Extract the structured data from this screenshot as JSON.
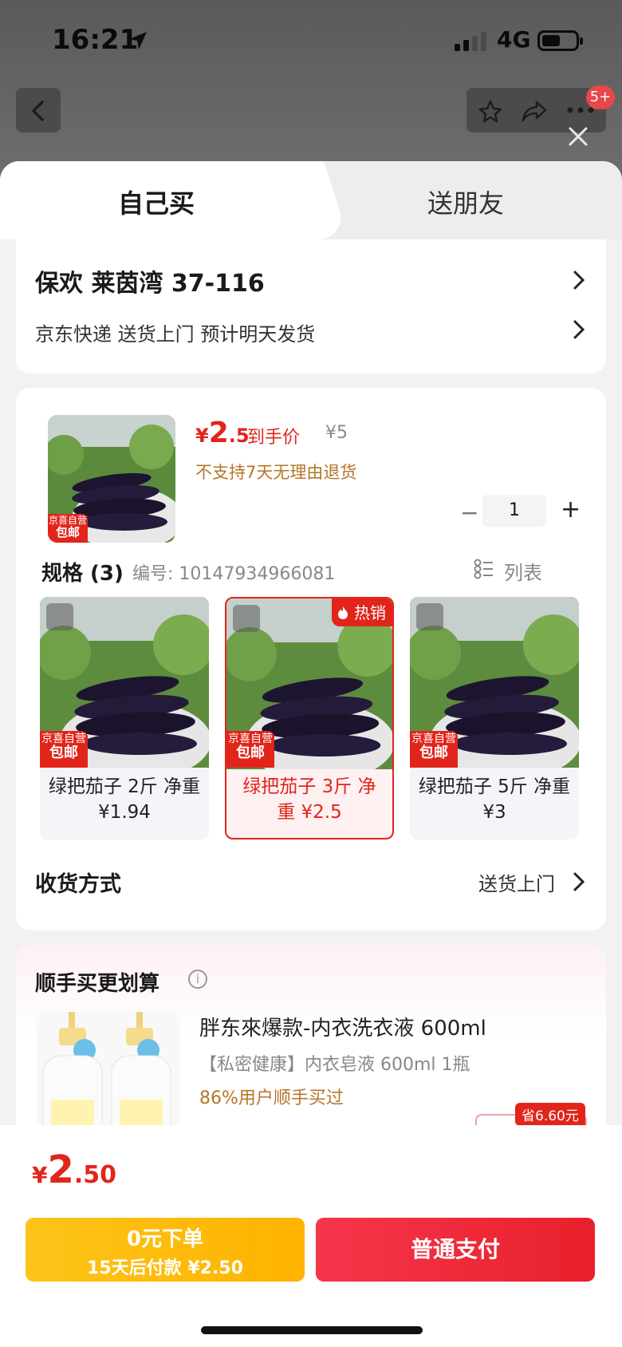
{
  "status_bar": {
    "time": "16:21",
    "network": "4G"
  },
  "nav": {
    "badge": "5+"
  },
  "tabs": {
    "self": "自己买",
    "friend": "送朋友"
  },
  "address": {
    "name_line": "保欢  莱茵湾 37-116",
    "delivery_line": "京东快递 送货上门 预计明天发货"
  },
  "product": {
    "tag_line1": "京喜自营",
    "tag_line2": "包邮",
    "price_yen": "¥",
    "price_int": "2",
    "price_dec": ".5",
    "price_label": "到手价",
    "original_price": "¥5",
    "return_policy": "不支持7天无理由退货",
    "quantity": "1",
    "minus": "−",
    "plus": "+"
  },
  "specs": {
    "title": "规格 (3)",
    "sku": "编号: 10147934966081",
    "list_label": "列表",
    "hot_label": "热销",
    "variants": [
      {
        "name": "绿把茄子 2斤 净重 ¥1.94",
        "selected": false
      },
      {
        "name": "绿把茄子 3斤 净重 ¥2.5",
        "selected": true
      },
      {
        "name": "绿把茄子 5斤 净重 ¥3",
        "selected": false
      }
    ]
  },
  "receiving": {
    "label": "收货方式",
    "value": "送货上门"
  },
  "addon": {
    "title": "顺手买更划算",
    "info": "i",
    "product_name": "胖东來爆款-内衣洗衣液 600ml",
    "product_sub": "【私密健康】内衣皂液 600ml 1瓶",
    "rate": "86%用户顺手买过",
    "save_badge": "省6.60元"
  },
  "bottom": {
    "total_yen": "¥",
    "total_int": "2",
    "total_dec": ".50",
    "credit_line1": "0元下单",
    "credit_line2": "15天后付款 ¥2.50",
    "pay_label": "普通支付"
  },
  "colors": {
    "accent": "#e1251b",
    "gold": "#ffb300",
    "pay": "#f5364b"
  }
}
